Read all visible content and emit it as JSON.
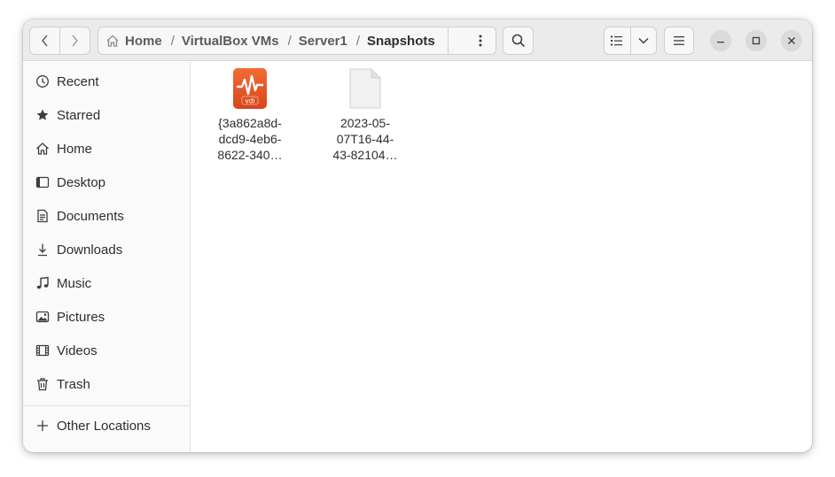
{
  "header": {
    "breadcrumbs": [
      {
        "label": "Home",
        "icon": "home-icon"
      },
      {
        "label": "VirtualBox VMs"
      },
      {
        "label": "Server1"
      },
      {
        "label": "Snapshots"
      }
    ],
    "separator": "/"
  },
  "sidebar": {
    "items": [
      {
        "label": "Recent",
        "icon": "clock-icon"
      },
      {
        "label": "Starred",
        "icon": "star-icon"
      },
      {
        "label": "Home",
        "icon": "home-icon"
      },
      {
        "label": "Desktop",
        "icon": "desktop-icon"
      },
      {
        "label": "Documents",
        "icon": "document-icon"
      },
      {
        "label": "Downloads",
        "icon": "download-icon"
      },
      {
        "label": "Music",
        "icon": "music-icon"
      },
      {
        "label": "Pictures",
        "icon": "picture-icon"
      },
      {
        "label": "Videos",
        "icon": "video-icon"
      },
      {
        "label": "Trash",
        "icon": "trash-icon"
      }
    ],
    "other_locations": {
      "label": "Other Locations",
      "icon": "plus-icon"
    }
  },
  "files": [
    {
      "name_lines": [
        "{3a862a8d-",
        "dcd9-4eb6-",
        "8622-340…"
      ],
      "icon": "vdi-disk-icon",
      "icon_text": "vdi",
      "icon_color": "#e95420"
    },
    {
      "name_lines": [
        "2023-05-",
        "07T16-44-",
        "43-82104…"
      ],
      "icon": "generic-file-icon"
    }
  ],
  "colors": {
    "accent": "#e95420",
    "headerbar": "#ebebeb",
    "sidebar": "#fafafa"
  }
}
